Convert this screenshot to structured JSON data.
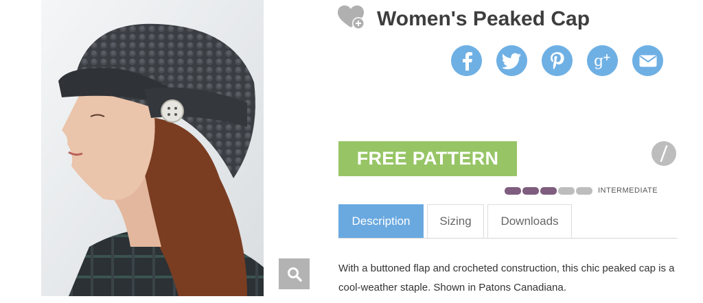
{
  "product": {
    "title": "Women's Peaked Cap",
    "photo_icon": "zoom-magnifier-icon"
  },
  "favorite": {
    "icon": "heart-add-icon"
  },
  "social": [
    {
      "name": "facebook",
      "glyph": "f"
    },
    {
      "name": "twitter",
      "glyph": "bird"
    },
    {
      "name": "pinterest",
      "glyph": "p"
    },
    {
      "name": "google-plus",
      "glyph": "g+"
    },
    {
      "name": "email",
      "glyph": "envelope"
    }
  ],
  "pattern_button": {
    "label": "FREE PATTERN"
  },
  "info_button": {
    "glyph": "/",
    "icon": "info-icon"
  },
  "skill": {
    "label": "INTERMEDIATE",
    "level": 3,
    "max": 5,
    "filled_color": "#7e5d7e",
    "empty_color": "#bdbdbd"
  },
  "tabs": [
    {
      "label": "Description",
      "active": true
    },
    {
      "label": "Sizing",
      "active": false
    },
    {
      "label": "Downloads",
      "active": false
    }
  ],
  "description": {
    "text": "With a buttoned flap and crocheted construction, this chic peaked cap is a cool-weather staple. Shown in Patons Canadiana."
  },
  "colors": {
    "social": "#6fb0e4",
    "pattern_button": "#97c566",
    "active_tab": "#6aa9e0"
  }
}
